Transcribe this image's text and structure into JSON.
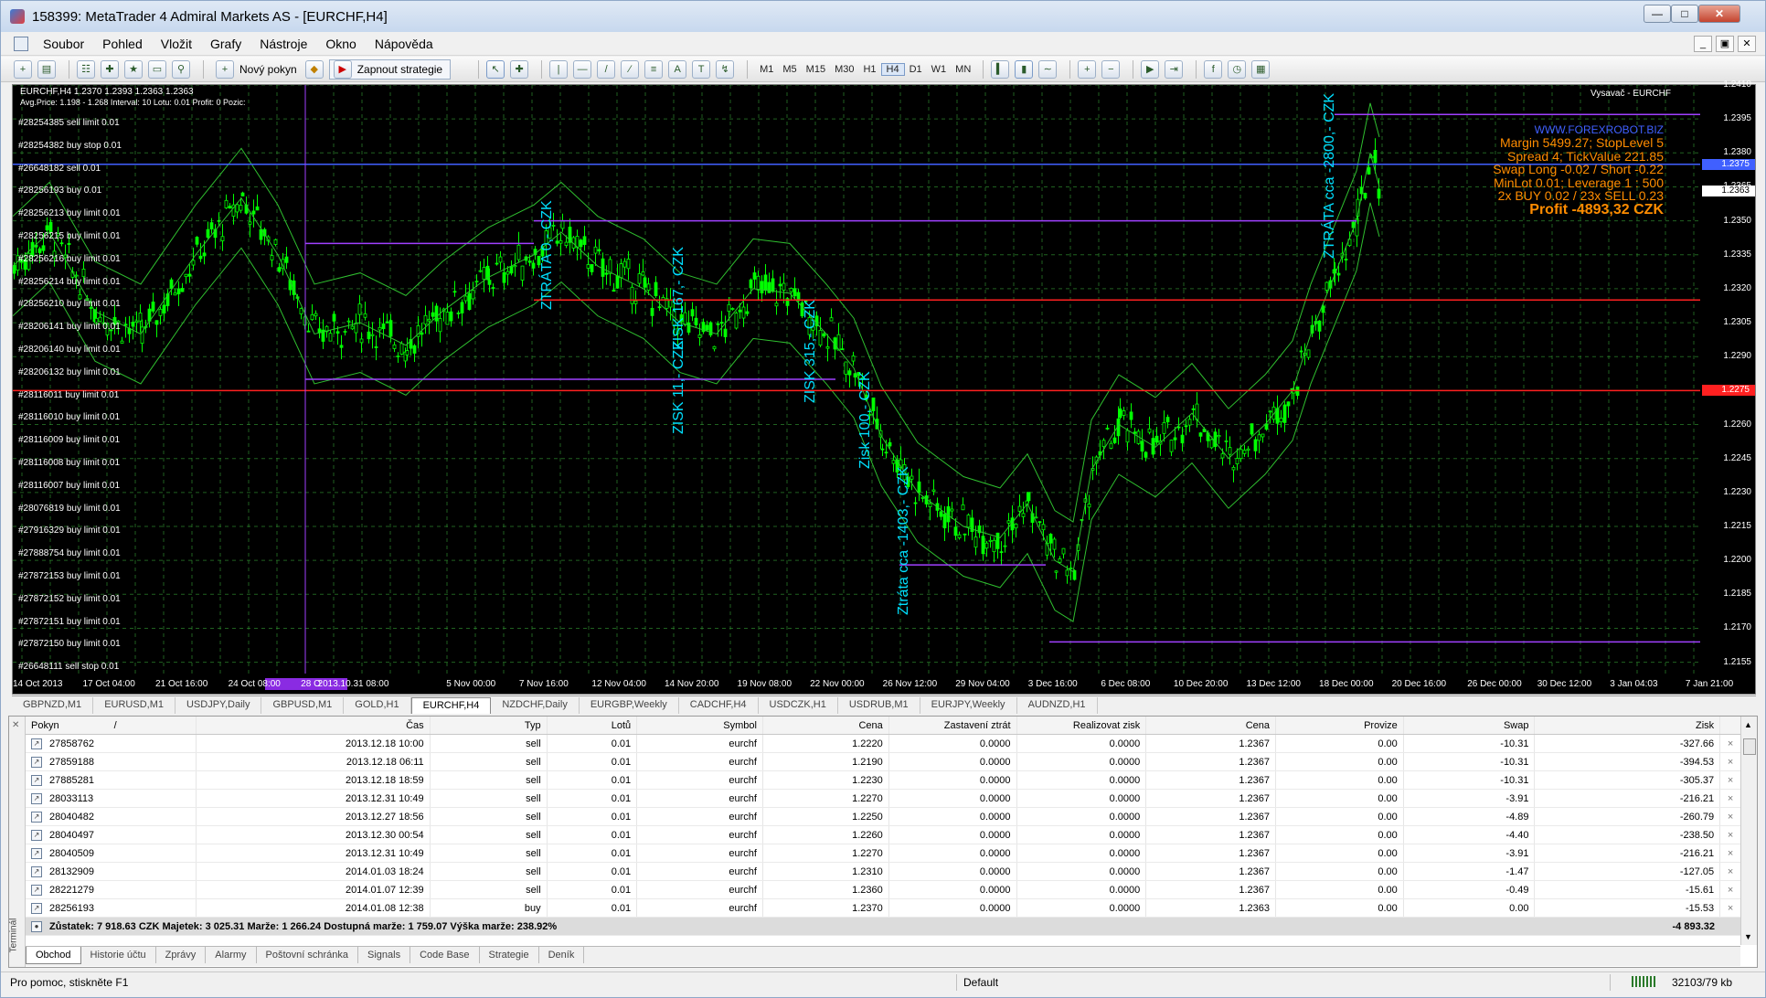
{
  "window": {
    "title": "158399: MetaTrader 4 Admiral Markets AS - [EURCHF,H4]"
  },
  "menu": [
    "Soubor",
    "Pohled",
    "Vložit",
    "Grafy",
    "Nástroje",
    "Okno",
    "Nápověda"
  ],
  "toolbar": {
    "new_order": "Nový pokyn",
    "autotrading": "Zapnout strategie",
    "periods": [
      "M1",
      "M5",
      "M15",
      "M30",
      "H1",
      "H4",
      "D1",
      "W1",
      "MN"
    ],
    "active_period": "H4"
  },
  "chart": {
    "header": "EURCHF,H4  1.2370 1.2393 1.2363 1.2363",
    "subheader": "Avg.Price: 1.198 - 1.268   Interval: 10   Lotu: 0.01   Profit: 0   Pozic:",
    "indicator_label": "Vysavač - EURCHF",
    "orders": [
      "#28254385 sell limit 0.01",
      "#28254382 buy stop 0.01",
      "#26648182 sell 0.01",
      "#28256193 buy 0.01",
      "#28256213 buy limit 0.01",
      "#28256215 buy limit 0.01",
      "#28256216 buy limit 0.01",
      "#28256214 buy limit 0.01",
      "#28256210 buy limit 0.01",
      "#28206141 buy limit 0.01",
      "#28206140 buy limit 0.01",
      "#28206132 buy limit 0.01",
      "#28116011 buy limit 0.01",
      "#28116010 buy limit 0.01",
      "#28116009 buy limit 0.01",
      "#28116008 buy limit 0.01",
      "#28116007 buy limit 0.01",
      "#28076819 buy limit 0.01",
      "#27916329 buy limit 0.01",
      "#27888754 buy limit 0.01",
      "#27872153 buy limit 0.01",
      "#27872152 buy limit 0.01",
      "#27872151 buy limit 0.01",
      "#27872150 buy limit 0.01",
      "#26648111 sell stop 0.01"
    ],
    "info_url": "WWW.FOREXROBOT.BIZ",
    "info_lines": [
      "Margin 5499.27; StopLevel 5",
      "Spread 4; TickValue 221.85",
      "Swap Long -0.02 / Short -0.22",
      "MinLot 0.01; Leverage 1 : 500",
      "2x BUY 0.02 / 23x SELL 0.23"
    ],
    "profit": "Profit -4893,32 CZK",
    "annotations": [
      "ZTRÁTA 0,- CZK",
      "ZISK 167,- CZK",
      "ZISK 315,- CZK",
      "Zisk 100,- CZK",
      "Ztráta cca -1403,- CZK",
      "ZTRÁTA cca -2800,- CZK",
      "ZISK 11,- CZK"
    ],
    "price_ticks": [
      "1.2410",
      "1.2395",
      "1.2380",
      "1.2365",
      "1.2350",
      "1.2335",
      "1.2320",
      "1.2305",
      "1.2290",
      "1.2275",
      "1.2260",
      "1.2245",
      "1.2230",
      "1.2215",
      "1.2200",
      "1.2185",
      "1.2170",
      "1.2155"
    ],
    "price_tag_blue": "1.2375",
    "price_tag_last": "1.2363",
    "price_tag_red": "1.2275",
    "time_ticks": [
      "14 Oct 2013",
      "17 Oct 04:00",
      "21 Oct 16:00",
      "24 Oct 08:00",
      "28 O",
      "2013.10.31 08:00",
      "5 Nov 00:00",
      "7 Nov 16:00",
      "12 Nov 04:00",
      "14 Nov 20:00",
      "19 Nov 08:00",
      "22 Nov 00:00",
      "26 Nov 12:00",
      "29 Nov 04:00",
      "3 Dec 16:00",
      "6 Dec 08:00",
      "10 Dec 20:00",
      "13 Dec 12:00",
      "18 Dec 00:00",
      "20 Dec 16:00",
      "26 Dec 00:00",
      "30 Dec 12:00",
      "3 Jan 04:03",
      "7 Jan 21:00"
    ],
    "colors": {
      "background": "#000000",
      "candles": "#00ff00",
      "grid": "#2e8b2e",
      "blue_line": "#4060ff",
      "red_line": "#ff2020",
      "violet_line": "#a040ff",
      "annotation": "#00e0ff",
      "info": "#ff8c00"
    }
  },
  "chart_tabs": [
    "GBPNZD,M1",
    "EURUSD,M1",
    "USDJPY,Daily",
    "GBPUSD,M1",
    "GOLD,H1",
    "EURCHF,H4",
    "NZDCHF,Daily",
    "EURGBP,Weekly",
    "CADCHF,H4",
    "USDCZK,H1",
    "USDRUB,M1",
    "EURJPY,Weekly",
    "AUDNZD,H1"
  ],
  "active_chart_tab": "EURCHF,H4",
  "terminal": {
    "columns": [
      "Pokyn",
      "Čas",
      "Typ",
      "Lotů",
      "Symbol",
      "Cena",
      "Zastavení ztrát",
      "Realizovat zisk",
      "Cena",
      "Provize",
      "Swap",
      "Zisk"
    ],
    "sort_marker": "/",
    "rows": [
      [
        "27858762",
        "2013.12.18 10:00",
        "sell",
        "0.01",
        "eurchf",
        "1.2220",
        "0.0000",
        "0.0000",
        "1.2367",
        "0.00",
        "-10.31",
        "-327.66"
      ],
      [
        "27859188",
        "2013.12.18 06:11",
        "sell",
        "0.01",
        "eurchf",
        "1.2190",
        "0.0000",
        "0.0000",
        "1.2367",
        "0.00",
        "-10.31",
        "-394.53"
      ],
      [
        "27885281",
        "2013.12.18 18:59",
        "sell",
        "0.01",
        "eurchf",
        "1.2230",
        "0.0000",
        "0.0000",
        "1.2367",
        "0.00",
        "-10.31",
        "-305.37"
      ],
      [
        "28033113",
        "2013.12.31 10:49",
        "sell",
        "0.01",
        "eurchf",
        "1.2270",
        "0.0000",
        "0.0000",
        "1.2367",
        "0.00",
        "-3.91",
        "-216.21"
      ],
      [
        "28040482",
        "2013.12.27 18:56",
        "sell",
        "0.01",
        "eurchf",
        "1.2250",
        "0.0000",
        "0.0000",
        "1.2367",
        "0.00",
        "-4.89",
        "-260.79"
      ],
      [
        "28040497",
        "2013.12.30 00:54",
        "sell",
        "0.01",
        "eurchf",
        "1.2260",
        "0.0000",
        "0.0000",
        "1.2367",
        "0.00",
        "-4.40",
        "-238.50"
      ],
      [
        "28040509",
        "2013.12.31 10:49",
        "sell",
        "0.01",
        "eurchf",
        "1.2270",
        "0.0000",
        "0.0000",
        "1.2367",
        "0.00",
        "-3.91",
        "-216.21"
      ],
      [
        "28132909",
        "2014.01.03 18:24",
        "sell",
        "0.01",
        "eurchf",
        "1.2310",
        "0.0000",
        "0.0000",
        "1.2367",
        "0.00",
        "-1.47",
        "-127.05"
      ],
      [
        "28221279",
        "2014.01.07 12:39",
        "sell",
        "0.01",
        "eurchf",
        "1.2360",
        "0.0000",
        "0.0000",
        "1.2367",
        "0.00",
        "-0.49",
        "-15.61"
      ],
      [
        "28256193",
        "2014.01.08 12:38",
        "buy",
        "0.01",
        "eurchf",
        "1.2370",
        "0.0000",
        "0.0000",
        "1.2363",
        "0.00",
        "0.00",
        "-15.53"
      ]
    ],
    "summary": "Zůstatek: 7 918.63 CZK  Majetek: 3 025.31  Marže: 1 266.24  Dostupná marže: 1 759.07  Výška marže: 238.92%",
    "summary_profit": "-4 893.32",
    "tabs": [
      "Obchod",
      "Historie účtu",
      "Zprávy",
      "Alarmy",
      "Poštovní schránka",
      "Signals",
      "Code Base",
      "Strategie",
      "Deník"
    ],
    "active_tab": "Obchod",
    "side_label": "Terminál"
  },
  "status": {
    "help": "Pro pomoc, stiskněte F1",
    "profile": "Default",
    "traffic": "32103/79 kb"
  }
}
